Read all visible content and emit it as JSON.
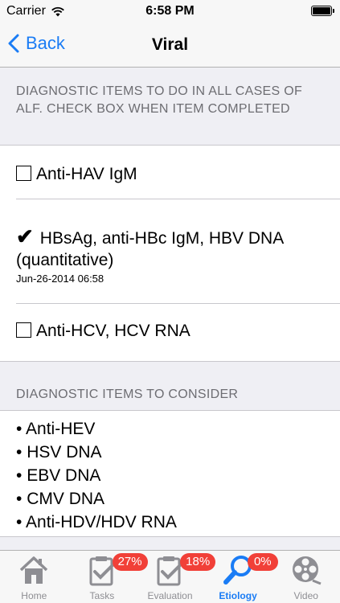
{
  "status_bar": {
    "carrier": "Carrier",
    "time": "6:58 PM"
  },
  "nav": {
    "back_label": "Back",
    "title": "Viral"
  },
  "sections": {
    "required_header": "DIAGNOSTIC ITEMS TO DO IN ALL CASES OF ALF.  CHECK BOX WHEN ITEM COMPLETED",
    "consider_header": "DIAGNOSTIC ITEMS TO CONSIDER"
  },
  "required_items": [
    {
      "label": "Anti-HAV IgM",
      "checked": false
    },
    {
      "label": "HBsAg, anti-HBc IgM, HBV DNA (quantitative)",
      "checked": true,
      "timestamp": "Jun-26-2014 06:58"
    },
    {
      "label": "Anti-HCV, HCV RNA",
      "checked": false
    }
  ],
  "consider_items": [
    "Anti-HEV",
    "HSV DNA",
    "EBV DNA",
    "CMV DNA",
    "Anti-HDV/HDV RNA"
  ],
  "tabs": [
    {
      "label": "Home",
      "icon": "home-icon"
    },
    {
      "label": "Tasks",
      "icon": "tasks-clipboard-icon",
      "badge": "27%"
    },
    {
      "label": "Evaluation",
      "icon": "evaluation-clipboard-icon",
      "badge": "18%"
    },
    {
      "label": "Etiology",
      "icon": "magnifier-icon",
      "badge": "0%",
      "active": true
    },
    {
      "label": "Video",
      "icon": "film-reel-icon"
    }
  ],
  "colors": {
    "accent": "#1a7cf5",
    "badge": "#f14038",
    "inactive": "#8e8e93"
  }
}
